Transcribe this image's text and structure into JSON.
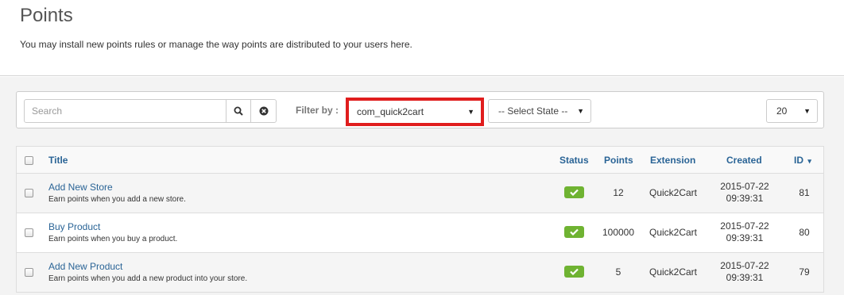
{
  "page": {
    "title": "Points",
    "description": "You may install new points rules or manage the way points are distributed to your users here."
  },
  "filters": {
    "search_placeholder": "Search",
    "filter_label": "Filter by :",
    "extension_value": "com_quick2cart",
    "state_value": "-- Select State --",
    "limit_value": "20"
  },
  "table": {
    "headers": {
      "title": "Title",
      "status": "Status",
      "points": "Points",
      "extension": "Extension",
      "created": "Created",
      "id": "ID"
    },
    "sort_indicator": "▾",
    "rows": [
      {
        "title": "Add New Store",
        "description": "Earn points when you add a new store.",
        "points": "12",
        "extension": "Quick2Cart",
        "created_date": "2015-07-22",
        "created_time": "09:39:31",
        "id": "81"
      },
      {
        "title": "Buy Product",
        "description": "Earn points when you buy a product.",
        "points": "100000",
        "extension": "Quick2Cart",
        "created_date": "2015-07-22",
        "created_time": "09:39:31",
        "id": "80"
      },
      {
        "title": "Add New Product",
        "description": "Earn points when you add a new product into your store.",
        "points": "5",
        "extension": "Quick2Cart",
        "created_date": "2015-07-22",
        "created_time": "09:39:31",
        "id": "79"
      }
    ]
  },
  "colors": {
    "link": "#2a6496",
    "status_published": "#6fb332",
    "highlight": "#e01d1d"
  },
  "icons": {
    "search": "search-icon",
    "clear": "clear-icon",
    "dropdown": "caret-down-icon",
    "published": "check-icon"
  }
}
